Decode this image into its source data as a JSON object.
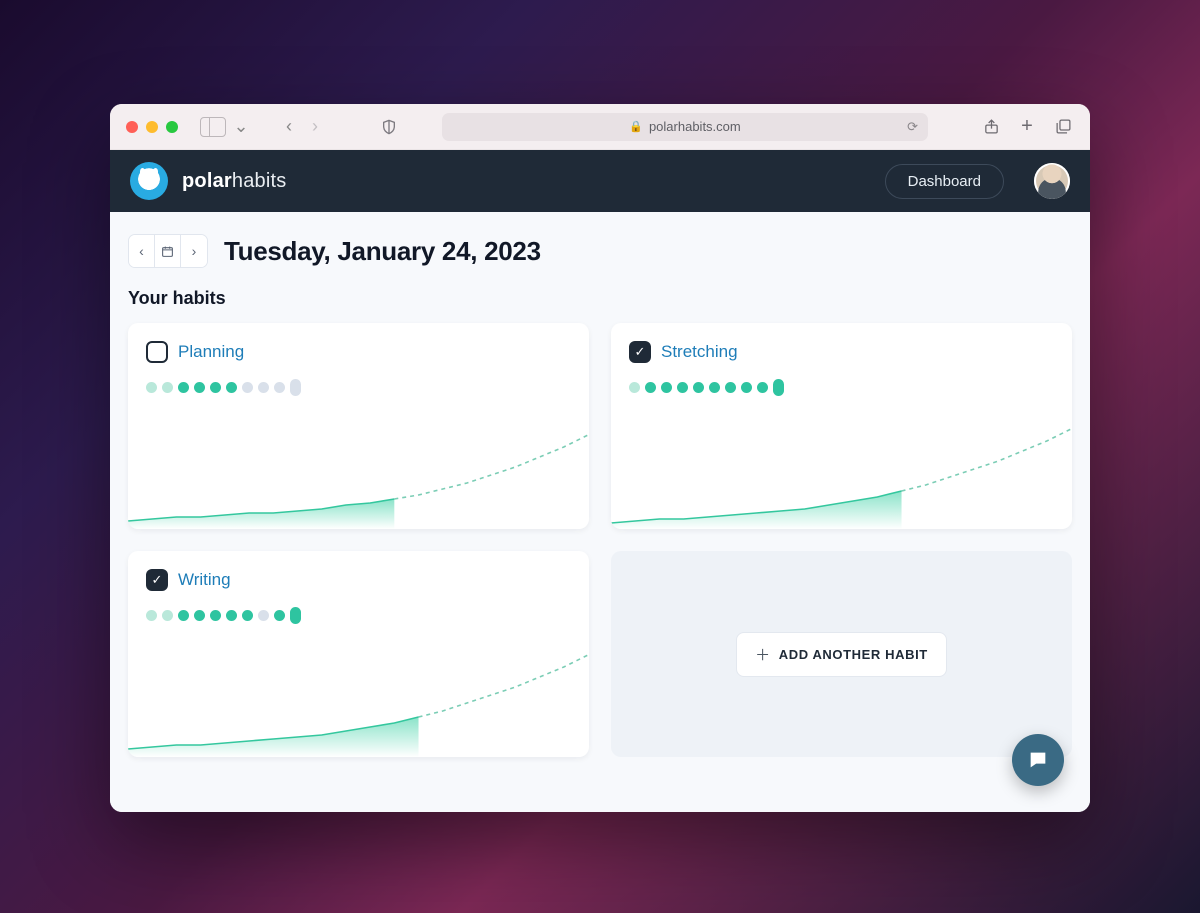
{
  "browser": {
    "url_display": "polarhabits.com"
  },
  "header": {
    "brand_bold": "polar",
    "brand_rest": "habits",
    "dashboard_label": "Dashboard"
  },
  "date": {
    "display": "Tuesday, January 24, 2023"
  },
  "section": {
    "habits_title": "Your habits"
  },
  "habits": [
    {
      "name": "Planning",
      "checked": false,
      "streak": [
        "faint",
        "faint",
        "on",
        "on",
        "on",
        "on",
        "off",
        "off",
        "off"
      ],
      "today_pill": "off"
    },
    {
      "name": "Stretching",
      "checked": true,
      "streak": [
        "faint",
        "on",
        "on",
        "on",
        "on",
        "on",
        "on",
        "on",
        "on"
      ],
      "today_pill": "on"
    },
    {
      "name": "Writing",
      "checked": true,
      "streak": [
        "faint",
        "faint",
        "on",
        "on",
        "on",
        "on",
        "on",
        "off",
        "on"
      ],
      "today_pill": "on"
    }
  ],
  "add_button": {
    "label": "ADD ANOTHER HABIT"
  },
  "chart_data": [
    {
      "type": "area",
      "title": "Planning progress",
      "x": [
        0,
        1,
        2,
        3,
        4,
        5,
        6,
        7,
        8,
        9,
        10,
        11,
        12,
        13,
        14,
        15,
        16,
        17,
        18,
        19
      ],
      "values": [
        4,
        5,
        6,
        6,
        7,
        8,
        8,
        9,
        10,
        12,
        13,
        15,
        17,
        20,
        23,
        27,
        31,
        36,
        41,
        47
      ],
      "solid_until_index": 11,
      "ylim": [
        0,
        60
      ]
    },
    {
      "type": "area",
      "title": "Stretching progress",
      "x": [
        0,
        1,
        2,
        3,
        4,
        5,
        6,
        7,
        8,
        9,
        10,
        11,
        12,
        13,
        14,
        15,
        16,
        17,
        18,
        19
      ],
      "values": [
        3,
        4,
        5,
        5,
        6,
        7,
        8,
        9,
        10,
        12,
        14,
        16,
        19,
        22,
        26,
        30,
        34,
        39,
        44,
        50
      ],
      "solid_until_index": 12,
      "ylim": [
        0,
        60
      ]
    },
    {
      "type": "area",
      "title": "Writing progress",
      "x": [
        0,
        1,
        2,
        3,
        4,
        5,
        6,
        7,
        8,
        9,
        10,
        11,
        12,
        13,
        14,
        15,
        16,
        17,
        18,
        19
      ],
      "values": [
        4,
        5,
        6,
        6,
        7,
        8,
        9,
        10,
        11,
        13,
        15,
        17,
        20,
        23,
        27,
        31,
        35,
        40,
        45,
        51
      ],
      "solid_until_index": 12,
      "ylim": [
        0,
        60
      ]
    }
  ]
}
